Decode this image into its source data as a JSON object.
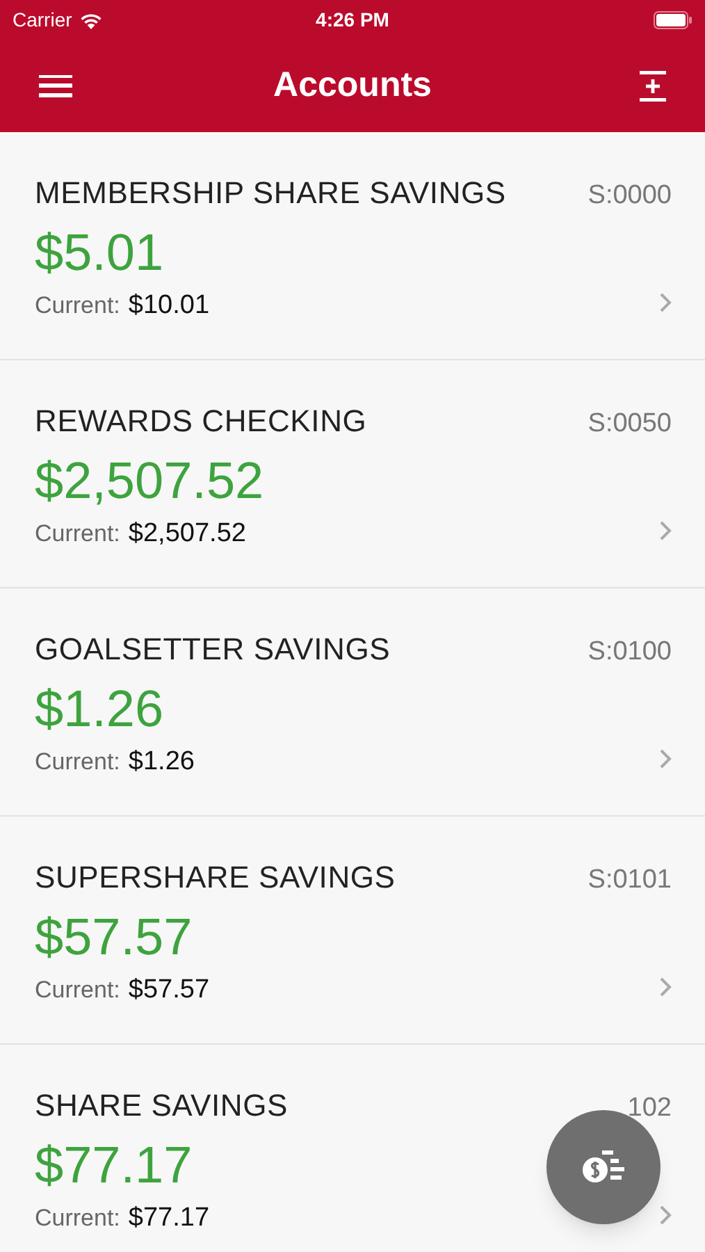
{
  "status_bar": {
    "carrier": "Carrier",
    "time": "4:26 PM"
  },
  "nav": {
    "title": "Accounts"
  },
  "accounts": [
    {
      "name": "MEMBERSHIP SHARE SAVINGS",
      "code": "S:0000",
      "balance": "$5.01",
      "current_label": "Current:",
      "current": "$10.01"
    },
    {
      "name": "REWARDS CHECKING",
      "code": "S:0050",
      "balance": "$2,507.52",
      "current_label": "Current:",
      "current": "$2,507.52"
    },
    {
      "name": "GOALSETTER SAVINGS",
      "code": "S:0100",
      "balance": "$1.26",
      "current_label": "Current:",
      "current": "$1.26"
    },
    {
      "name": "SUPERSHARE SAVINGS",
      "code": "S:0101",
      "balance": "$57.57",
      "current_label": "Current:",
      "current": "$57.57"
    },
    {
      "name": "SHARE SAVINGS",
      "code": "102",
      "balance": "$77.17",
      "current_label": "Current:",
      "current": "$77.17"
    }
  ]
}
